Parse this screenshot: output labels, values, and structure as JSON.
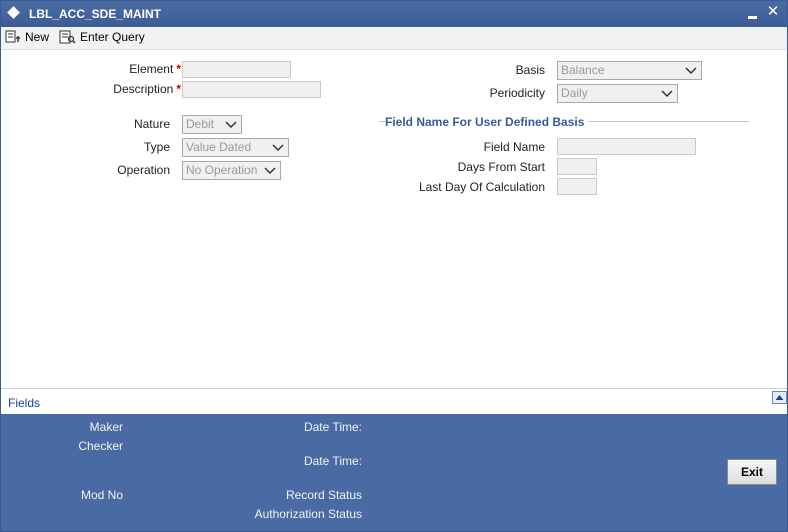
{
  "window": {
    "title": "LBL_ACC_SDE_MAINT"
  },
  "toolbar": {
    "new_label": "New",
    "enter_query_label": "Enter Query"
  },
  "form": {
    "element_label": "Element",
    "description_label": "Description",
    "required_marker": "*",
    "nature_label": "Nature",
    "nature_value": "Debit",
    "type_label": "Type",
    "type_value": "Value Dated",
    "operation_label": "Operation",
    "operation_value": "No Operation",
    "basis_label": "Basis",
    "basis_value": "Balance",
    "periodicity_label": "Periodicity",
    "periodicity_value": "Daily"
  },
  "user_defined_basis": {
    "section_title": "Field Name For User Defined Basis",
    "field_name_label": "Field Name",
    "days_from_start_label": "Days From Start",
    "last_day_label": "Last Day Of Calculation"
  },
  "fields_bar": {
    "label": "Fields"
  },
  "audit": {
    "maker_label": "Maker",
    "checker_label": "Checker",
    "mod_no_label": "Mod No",
    "date_time_label_1": "Date Time:",
    "date_time_label_2": "Date Time:",
    "record_status_label": "Record Status",
    "authorization_status_label": "Authorization Status",
    "exit_label": "Exit"
  },
  "colors": {
    "titlebar": "#3b5c95",
    "audit_panel": "#4a6aa3",
    "required": "#c00000",
    "section_title": "#3a5a94"
  }
}
